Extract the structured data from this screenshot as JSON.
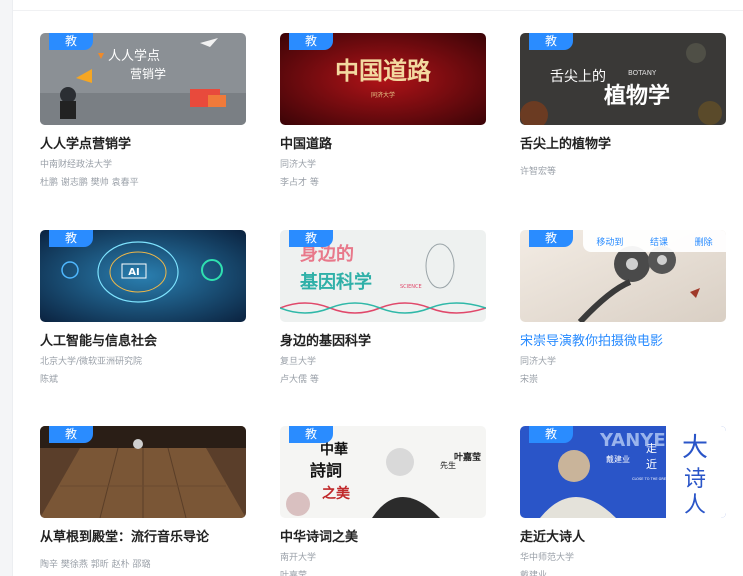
{
  "badge_label": "教",
  "courses": [
    {
      "title": "人人学点营销学",
      "school": "中南财经政法大学",
      "teacher": "杜鹏 谢志鹏 樊帅 袁春平",
      "thumb_text": [
        "人人学点",
        "营销学"
      ]
    },
    {
      "title": "中国道路",
      "school": "同济大学",
      "teacher": "李占才 等",
      "thumb_text": [
        "中国道路",
        "同济大学"
      ]
    },
    {
      "title": "舌尖上的植物学",
      "school": "",
      "teacher": "许智宏等",
      "thumb_text": [
        "舌尖上的",
        "植物学",
        "BOTANY"
      ]
    },
    {
      "title": "人工智能与信息社会",
      "school": "北京大学/微软亚洲研究院",
      "teacher": "陈斌",
      "thumb_text": [
        "AI"
      ]
    },
    {
      "title": "身边的基因科学",
      "school": "复旦大学",
      "teacher": "卢大儒 等",
      "thumb_text": [
        "身边的",
        "基因科学",
        "SCIENCE"
      ]
    },
    {
      "title": "宋崇导演教你拍摄微电影",
      "school": "同济大学",
      "teacher": "宋崇",
      "thumb_text": []
    },
    {
      "title": "从草根到殿堂：流行音乐导论",
      "school": "",
      "teacher": "陶辛 樊徐燕 郭昕 赵朴 邵璐",
      "thumb_text": []
    },
    {
      "title": "中华诗词之美",
      "school": "南开大学",
      "teacher": "叶嘉莹",
      "thumb_text": [
        "中華",
        "詩詞",
        "之美",
        "先生",
        "叶嘉莹"
      ]
    },
    {
      "title": "走近大诗人",
      "school": "华中师范大学",
      "teacher": "戴建业",
      "thumb_text": [
        "YANYE",
        "戴建业",
        "走",
        "近",
        "大",
        "诗",
        "人",
        "CLOSE TO THE GREAT POETS"
      ]
    }
  ],
  "hover_actions": {
    "move": "移动到",
    "finish": "结课",
    "delete": "删除"
  },
  "colors": {
    "accent": "#2a8cff",
    "badge": "#2a8cff"
  }
}
